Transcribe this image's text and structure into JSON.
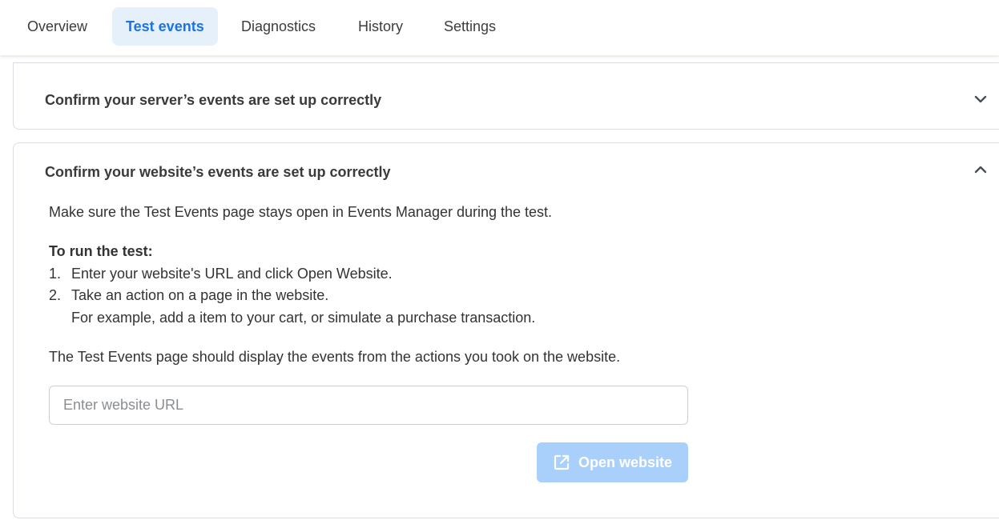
{
  "tabs": [
    {
      "label": "Overview",
      "active": false
    },
    {
      "label": "Test events",
      "active": true
    },
    {
      "label": "Diagnostics",
      "active": false
    },
    {
      "label": "History",
      "active": false
    },
    {
      "label": "Settings",
      "active": false
    }
  ],
  "server_section": {
    "title": "Confirm your server’s events are set up correctly",
    "expanded": false,
    "icon": "chevron-down-icon"
  },
  "website_section": {
    "title": "Confirm your website’s events are set up correctly",
    "expanded": true,
    "icon": "chevron-up-icon",
    "intro": "Make sure the Test Events page stays open in Events Manager during the test.",
    "run_heading": "To run the test:",
    "steps": [
      {
        "num": "1.",
        "text": "Enter your website's URL and click Open Website."
      },
      {
        "num": "2.",
        "text": "Take an action on a page in the website."
      }
    ],
    "step_example": "For example, add a item to your cart, or simulate a purchase transaction.",
    "outro": "The Test Events page should display the events from the actions you took on the website.",
    "url_input": {
      "placeholder": "Enter website URL",
      "value": ""
    },
    "open_button": {
      "label": "Open website",
      "icon": "external-link-icon",
      "disabled": true
    }
  },
  "colors": {
    "accent": "#1a73e8",
    "active_tab_bg": "#e6f0fb",
    "disabled_button_bg": "#a8d0fb",
    "border": "#dadde1"
  }
}
